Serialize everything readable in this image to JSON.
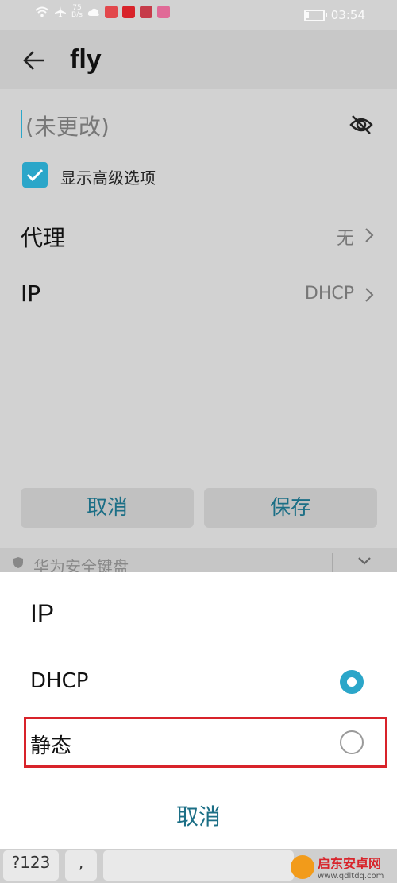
{
  "status_bar": {
    "speed_value": "75",
    "speed_unit": "B/s",
    "time": "03:54"
  },
  "app_bar": {
    "title": "fly"
  },
  "password_field": {
    "placeholder": "(未更改)"
  },
  "advanced": {
    "label": "显示高级选项",
    "checked": true
  },
  "rows": [
    {
      "label": "代理",
      "value": "无"
    },
    {
      "label": "IP",
      "value": "DHCP"
    }
  ],
  "buttons": {
    "cancel": "取消",
    "save": "保存"
  },
  "keyboard_bar": {
    "label": "华为安全键盘"
  },
  "dialog": {
    "title": "IP",
    "options": [
      {
        "label": "DHCP",
        "selected": true
      },
      {
        "label": "静态",
        "selected": false
      }
    ],
    "cancel": "取消"
  },
  "keyboard": {
    "key_123": "?123",
    "key_comma": ","
  },
  "watermark": {
    "name": "启东安卓网",
    "url": "www.qdltdq.com"
  },
  "colors": {
    "accent": "#2ba6c9",
    "button_text": "#1c6f86",
    "highlight": "#d8232a"
  }
}
